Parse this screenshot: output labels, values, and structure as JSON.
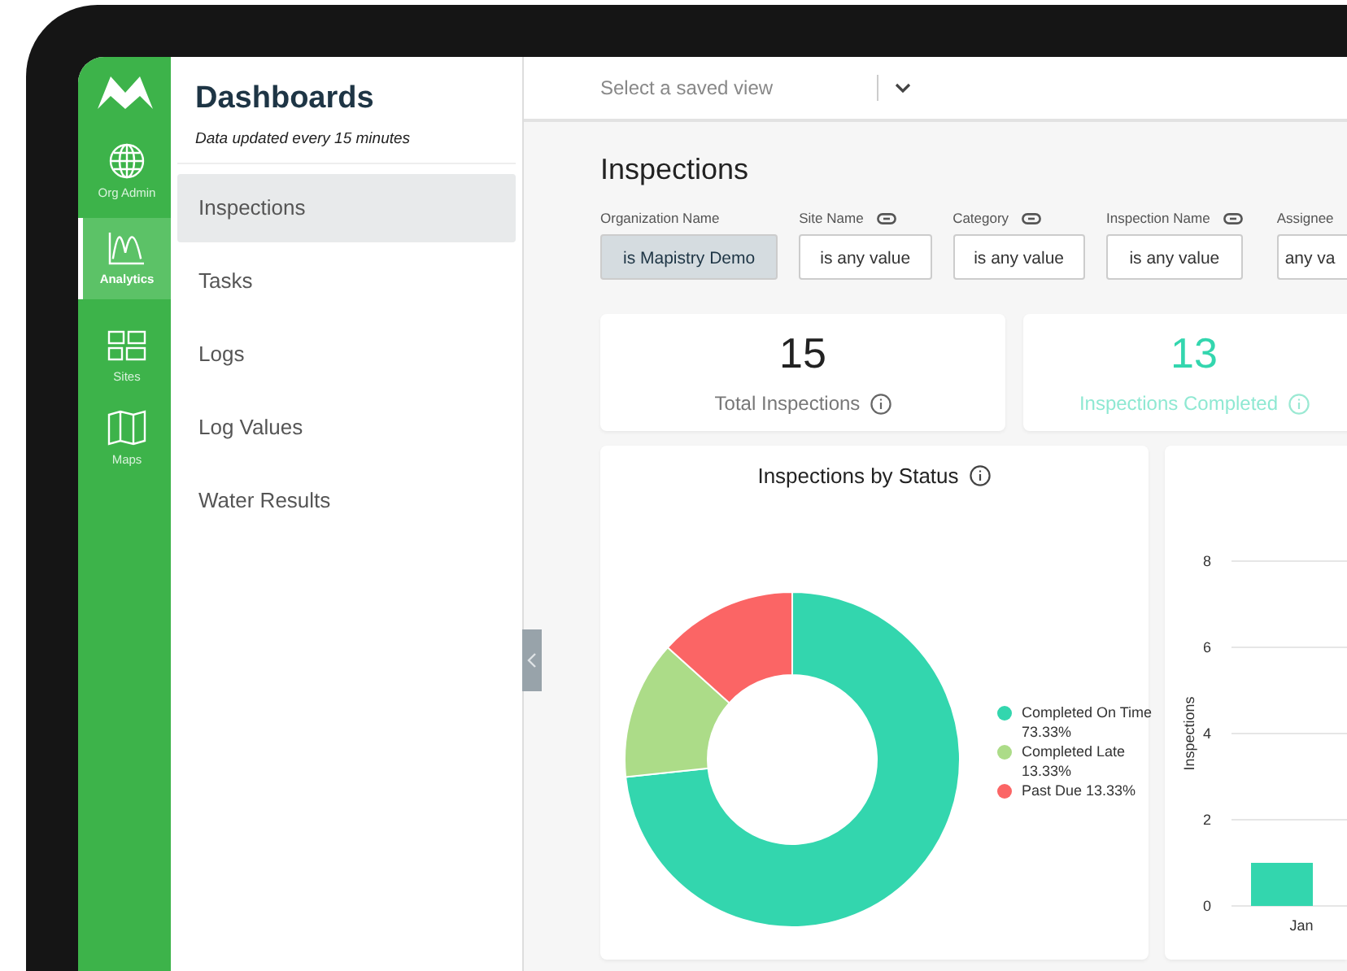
{
  "rail": {
    "items": [
      {
        "label": "Org Admin",
        "selected": false
      },
      {
        "label": "Analytics",
        "selected": true
      },
      {
        "label": "Sites",
        "selected": false
      },
      {
        "label": "Maps",
        "selected": false
      }
    ]
  },
  "sidebar": {
    "title": "Dashboards",
    "subtitle": "Data updated every 15 minutes",
    "items": [
      {
        "label": "Inspections",
        "selected": true
      },
      {
        "label": "Tasks",
        "selected": false
      },
      {
        "label": "Logs",
        "selected": false
      },
      {
        "label": "Log Values",
        "selected": false
      },
      {
        "label": "Water Results",
        "selected": false
      }
    ]
  },
  "top_bar": {
    "saved_view": {
      "placeholder": "Select a saved view"
    }
  },
  "page_title": "Inspections",
  "filters": [
    {
      "label": "Organization Name",
      "value": "is Mapistry Demo",
      "linked": false,
      "active": true
    },
    {
      "label": "Site Name",
      "value": "is any value",
      "linked": true,
      "active": false
    },
    {
      "label": "Category",
      "value": "is any value",
      "linked": true,
      "active": false
    },
    {
      "label": "Inspection Name",
      "value": "is any value",
      "linked": true,
      "active": false
    },
    {
      "label": "Assignee",
      "value": "any va",
      "linked": false,
      "active": false
    }
  ],
  "kpis": [
    {
      "value": "15",
      "label": "Total Inspections",
      "color": "#222222"
    },
    {
      "value": "13",
      "label": "Inspections Completed",
      "color": "#33d6ae"
    }
  ],
  "status_chart": {
    "title": "Inspections by Status",
    "chart_data": {
      "type": "donut",
      "categories": [
        "Completed On Time 73.33%",
        "Completed Late 13.33%",
        "Past Due 13.33%"
      ],
      "values": [
        73.33,
        13.33,
        13.33
      ],
      "colors": [
        "#33d6ae",
        "#acdc88",
        "#fb6565"
      ]
    }
  },
  "monthly_chart": {
    "chart_data": {
      "type": "bar",
      "ylabel": "Inspections",
      "categories": [
        "Jan"
      ],
      "values": [
        1
      ],
      "ylim": [
        0,
        8
      ],
      "yticks": [
        0,
        2,
        4,
        6,
        8
      ],
      "grid": true
    }
  }
}
